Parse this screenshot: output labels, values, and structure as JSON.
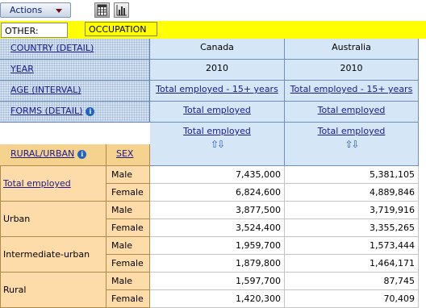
{
  "toolbar": {
    "actions_label": "Actions",
    "actions_icon": "dropdown-arrow-icon",
    "table_view_icon": "table-view-icon",
    "chart_view_icon": "chart-view-icon"
  },
  "filters": {
    "other_label": "OTHER:",
    "occupation_label": "OCCUPATION",
    "highlight_color": "#ffff00"
  },
  "column_headers": {
    "country": {
      "label": "COUNTRY (DETAIL)",
      "values": [
        "Canada",
        "Australia"
      ]
    },
    "year": {
      "label": "YEAR",
      "values": [
        "2010",
        "2010"
      ]
    },
    "age": {
      "label": "AGE (INTERVAL)",
      "values": [
        "Total employed - 15+ years",
        "Total employed - 15+ years"
      ]
    },
    "forms": {
      "label": "FORMS (DETAIL)",
      "values": [
        "Total employed",
        "Total employed"
      ]
    },
    "measure": {
      "values": [
        "Total employed",
        "Total employed"
      ]
    }
  },
  "row_headers": {
    "rural_urban_label": "RURAL/URBAN",
    "sex_label": "SEX"
  },
  "rows": [
    {
      "group": "Total employed",
      "group_is_link": true,
      "items": [
        {
          "sex": "Male",
          "values": [
            "7,435,000",
            "5,381,105"
          ]
        },
        {
          "sex": "Female",
          "values": [
            "6,824,600",
            "4,889,846"
          ]
        }
      ]
    },
    {
      "group": "Urban",
      "group_is_link": false,
      "items": [
        {
          "sex": "Male",
          "values": [
            "3,877,500",
            "3,719,916"
          ]
        },
        {
          "sex": "Female",
          "values": [
            "3,524,400",
            "3,355,265"
          ]
        }
      ]
    },
    {
      "group": "Intermediate-urban",
      "group_is_link": false,
      "items": [
        {
          "sex": "Male",
          "values": [
            "1,959,700",
            "1,573,444"
          ]
        },
        {
          "sex": "Female",
          "values": [
            "1,879,800",
            "1,464,171"
          ]
        }
      ]
    },
    {
      "group": "Rural",
      "group_is_link": false,
      "items": [
        {
          "sex": "Male",
          "values": [
            "1,597,700",
            "87,745"
          ]
        },
        {
          "sex": "Female",
          "values": [
            "1,420,300",
            "70,409"
          ]
        }
      ]
    }
  ]
}
